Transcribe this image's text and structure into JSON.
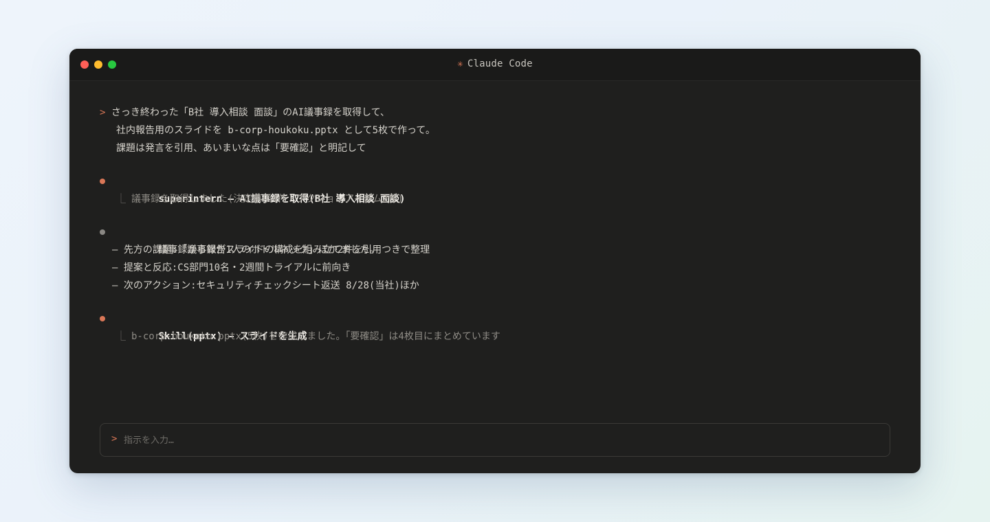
{
  "window": {
    "title_icon": "✳",
    "title": "Claude Code"
  },
  "user_prompt": {
    "marker": ">",
    "lines": [
      "さっき終わった「B社 導入相談 面談」のAI議事録を取得して、",
      "社内報告用のスライドを b-corp-houkoku.pptx として5枚で作って。",
      "課題は発言を引用、あいまいな点は「要確認」と明記して"
    ]
  },
  "tool_call_1": {
    "title": "superintern — AI議事録を取得(B社 導入相談 面談)",
    "result": "議事録を取得しました(決定事項4件・アクションアイテム2件)"
  },
  "assistant_message": {
    "text": "議事録から報告スライドの構成を組み立てました。",
    "items": [
      "— 先方の課題:「議事録が1人のボトルネック」ほか2件を引用つきで整理",
      "— 提案と反応:CS部門10名・2週間トライアルに前向き",
      "— 次のアクション:セキュリティチェックシート返送 8/28(当社)ほか"
    ]
  },
  "tool_call_2": {
    "title": "Skill(pptx) — スライドを生成",
    "result": "b-corp-houkoku.pptx(5枚)を作成しました。「要確認」は4枚目にまとめています"
  },
  "input": {
    "marker": ">",
    "placeholder": "指示を入力…"
  },
  "colors": {
    "accent": "#d97757",
    "background": "#1f1f1e",
    "titlebar": "#1a1a19"
  },
  "icons": {
    "tree_connector": "⎿"
  }
}
